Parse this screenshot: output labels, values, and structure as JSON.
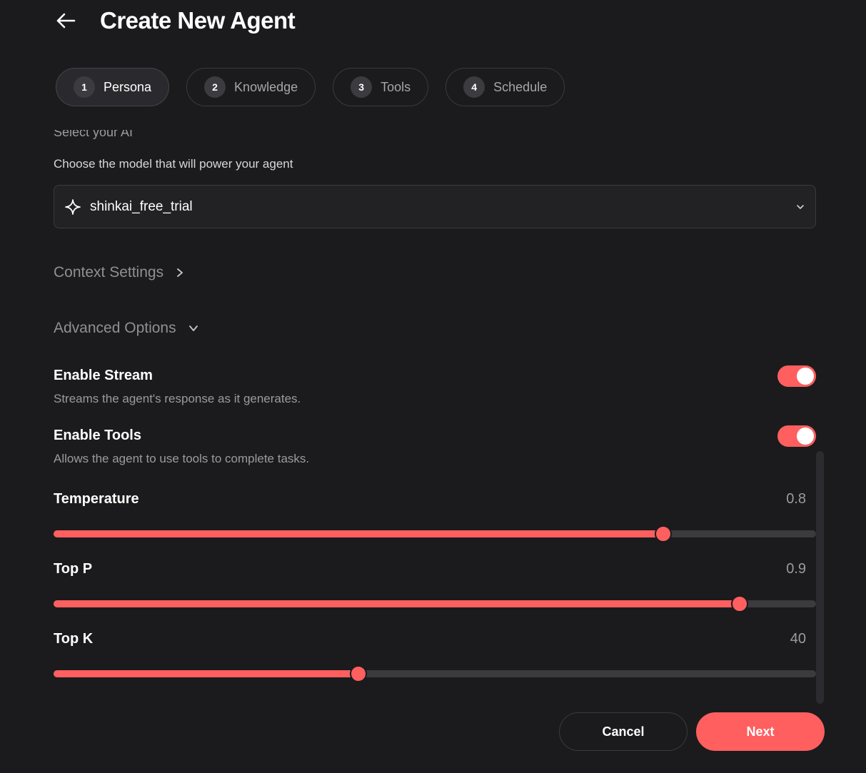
{
  "header": {
    "title": "Create New Agent"
  },
  "steps": [
    {
      "num": "1",
      "label": "Persona",
      "active": true
    },
    {
      "num": "2",
      "label": "Knowledge"
    },
    {
      "num": "3",
      "label": "Tools"
    },
    {
      "num": "4",
      "label": "Schedule"
    }
  ],
  "model": {
    "cutoff_label": "Select your AI",
    "description": "Choose the model that will power your agent",
    "selected": "shinkai_free_trial"
  },
  "sections": {
    "context": "Context Settings",
    "advanced": "Advanced Options"
  },
  "settings": {
    "stream": {
      "title": "Enable Stream",
      "desc": "Streams the agent's response as it generates.",
      "enabled": true
    },
    "tools": {
      "title": "Enable Tools",
      "desc": "Allows the agent to use tools to complete tasks.",
      "enabled": true
    }
  },
  "sliders": {
    "temperature": {
      "label": "Temperature",
      "value": "0.8",
      "level": 0.8
    },
    "top_p": {
      "label": "Top P",
      "value": "0.9",
      "level": 0.9
    },
    "top_k": {
      "label": "Top K",
      "value": "40",
      "level": 0.4
    }
  },
  "buttons": {
    "cancel": "Cancel",
    "next": "Next"
  },
  "colors": {
    "accent": "#ff5f5f",
    "background": "#1b1b1d",
    "track": "#3a3a3f"
  }
}
